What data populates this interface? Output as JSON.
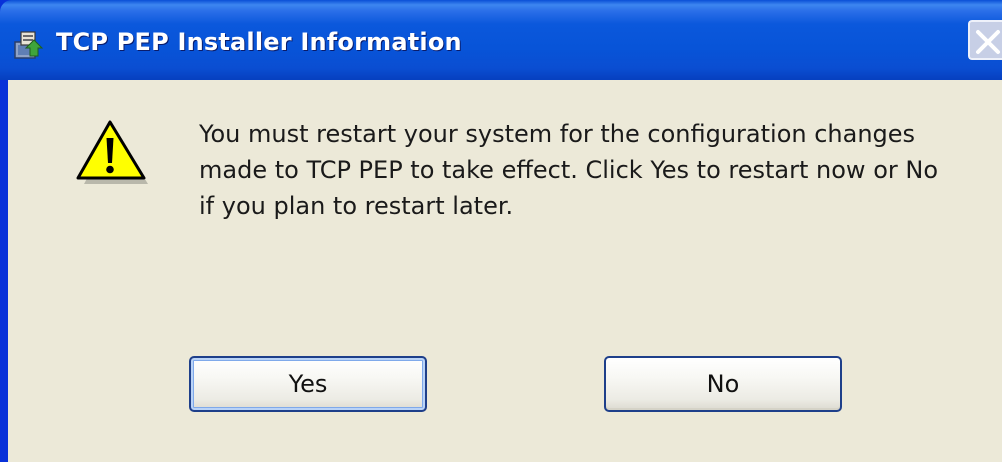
{
  "window": {
    "title": "TCP PEP Installer Information",
    "app_icon": "installer-icon",
    "close_icon": "close-icon"
  },
  "dialog": {
    "icon": "warning-icon",
    "message": "You must restart your system for the configuration changes made to TCP PEP to take effect. Click Yes to restart now or No if you plan to restart later."
  },
  "buttons": {
    "yes_label": "Yes",
    "no_label": "No"
  },
  "colors": {
    "titlebar": "#0854d8",
    "client_background": "#ece9d8",
    "button_border": "#1e3f8a",
    "warning_fill": "#ffff00"
  }
}
